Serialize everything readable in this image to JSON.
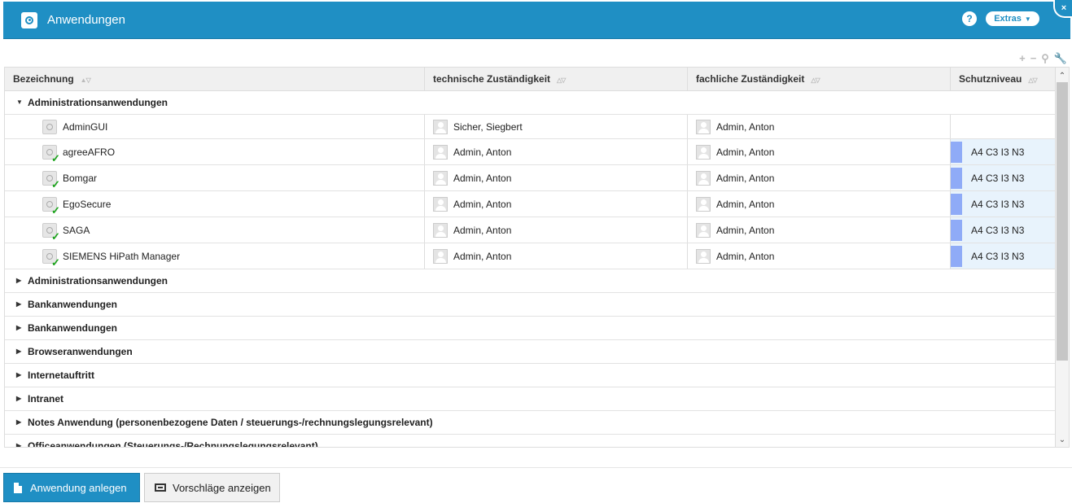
{
  "window": {
    "title": "Anwendungen",
    "help_label": "?",
    "extras_label": "Extras",
    "close_label": "×"
  },
  "toolbar": {
    "add": "+",
    "remove": "−",
    "search": "⚲",
    "settings": "🔧"
  },
  "columns": [
    "Bezeichnung",
    "technische Zuständigkeit",
    "fachliche Zuständigkeit",
    "Schutzniveau"
  ],
  "expanded_group": {
    "label": "Administrationsanwendungen",
    "rows": [
      {
        "name": "AdminGUI",
        "tech": "Sicher, Siegbert",
        "fach": "Admin, Anton",
        "schutz": "",
        "released": false
      },
      {
        "name": "agreeAFRO",
        "tech": "Admin, Anton",
        "fach": "Admin, Anton",
        "schutz": "A4 C3 I3 N3",
        "released": true
      },
      {
        "name": "Bomgar",
        "tech": "Admin, Anton",
        "fach": "Admin, Anton",
        "schutz": "A4 C3 I3 N3",
        "released": true
      },
      {
        "name": "EgoSecure",
        "tech": "Admin, Anton",
        "fach": "Admin, Anton",
        "schutz": "A4 C3 I3 N3",
        "released": true
      },
      {
        "name": "SAGA",
        "tech": "Admin, Anton",
        "fach": "Admin, Anton",
        "schutz": "A4 C3 I3 N3",
        "released": true
      },
      {
        "name": "SIEMENS HiPath Manager",
        "tech": "Admin, Anton",
        "fach": "Admin, Anton",
        "schutz": "A4 C3 I3 N3",
        "released": true
      }
    ]
  },
  "collapsed_groups": [
    "Administrationsanwendungen",
    "Bankanwendungen",
    "Bankanwendungen",
    "Browseranwendungen",
    "Internetauftritt",
    "Intranet",
    "Notes Anwendung (personenbezogene Daten / steuerungs-/rechnungslegungsrelevant)",
    "Officeanwendungen (Steuerungs-/Rechnungslegungsrelevant)"
  ],
  "colors": {
    "accent": "#1f8fc4",
    "schutz_bar": "#8fabf7",
    "schutz_bg": "#e8f3fc",
    "check": "#1da51d"
  },
  "footer": {
    "create_label": "Anwendung anlegen",
    "suggest_label": "Vorschläge anzeigen"
  }
}
